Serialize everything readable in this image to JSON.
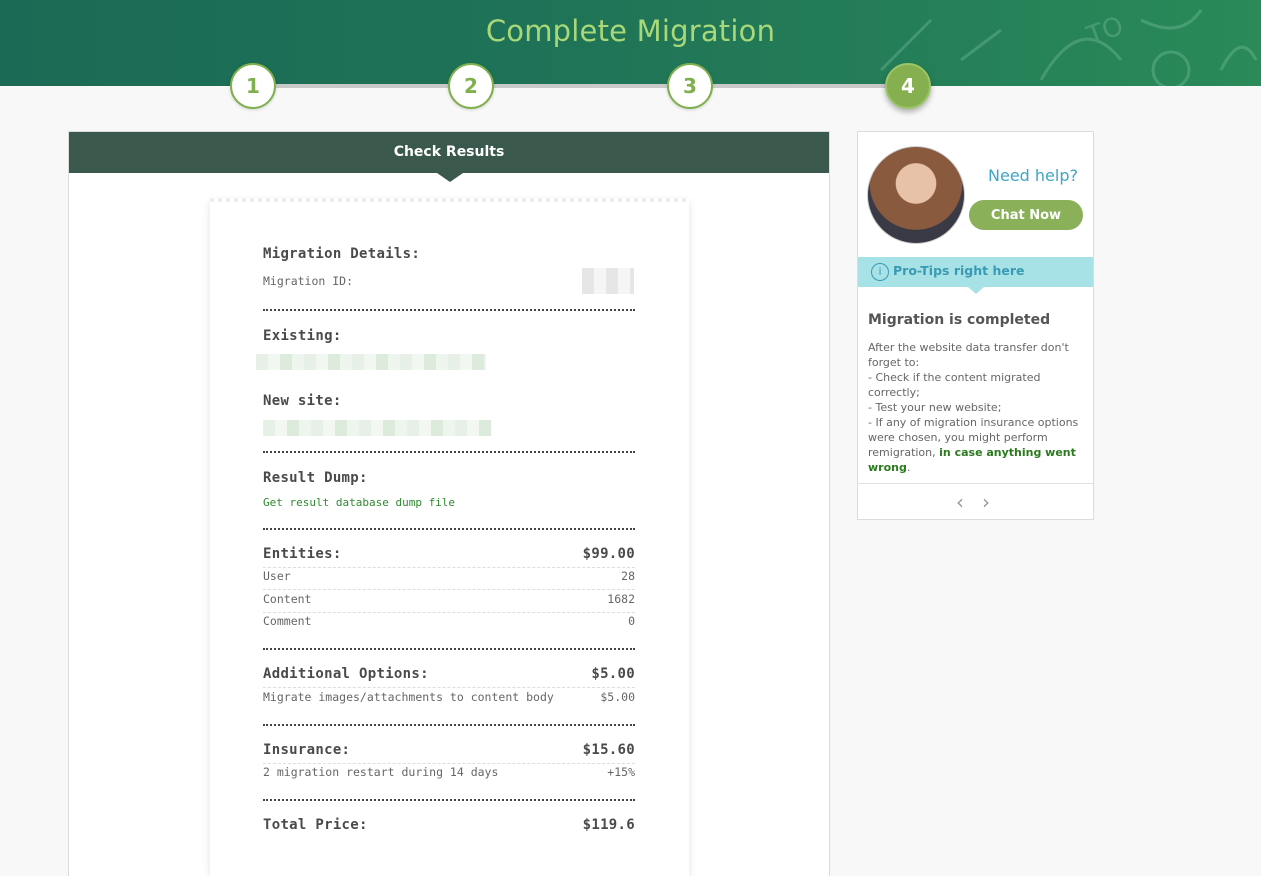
{
  "header": {
    "title": "Complete Migration"
  },
  "steps": [
    "1",
    "2",
    "3",
    "4"
  ],
  "main": {
    "panel_title": "Check Results",
    "receipt": {
      "details_title": "Migration Details:",
      "migration_id_label": "Migration ID:",
      "existing_label": "Existing:",
      "new_site_label": "New site:",
      "result_dump_label": "Result Dump:",
      "result_dump_link": "Get result database dump file",
      "entities": {
        "label": "Entities:",
        "total": "$99.00",
        "rows": [
          {
            "name": "User",
            "value": "28"
          },
          {
            "name": "Content",
            "value": "1682"
          },
          {
            "name": "Comment",
            "value": "0"
          }
        ]
      },
      "additional": {
        "label": "Additional Options:",
        "total": "$5.00",
        "rows": [
          {
            "name": "Migrate images/attachments to content body",
            "value": "$5.00"
          }
        ]
      },
      "insurance": {
        "label": "Insurance:",
        "total": "$15.60",
        "rows": [
          {
            "name": "2 migration restart during 14 days",
            "value": "+15%"
          }
        ]
      },
      "total_label": "Total Price:",
      "total_value": "$119.6"
    }
  },
  "side": {
    "need_help": "Need help?",
    "chat_button": "Chat Now",
    "tips_bar": "Pro-Tips right here",
    "tip_title": "Migration is completed",
    "tip_lines": [
      "After the website data transfer don't forget to:",
      "- Check if the content migrated correctly;",
      "- Test your new website;",
      "- If any of migration insurance options were chosen, you might perform remigration,"
    ],
    "tip_highlight": "in case anything went wrong",
    "tip_end": ".",
    "prev_arrow": "‹",
    "next_arrow": "›"
  }
}
